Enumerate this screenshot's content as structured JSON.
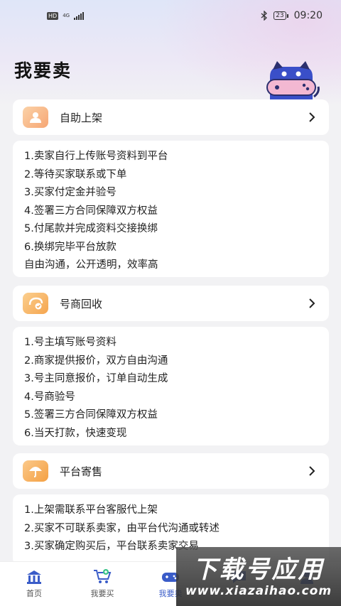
{
  "statusbar": {
    "hd": "HD",
    "network": "4G",
    "battery": "23",
    "time": "09:20"
  },
  "page": {
    "title": "我要卖"
  },
  "cards": [
    {
      "label": "自助上架",
      "icon": "user-icon",
      "lines": [
        "1.卖家自行上传账号资料到平台",
        "2.等待买家联系或下单",
        "3.买家付定金并验号",
        "4.签署三方合同保障双方权益",
        "5.付尾款并完成资料交接换绑",
        "6.换绑完毕平台放款",
        "自由沟通，公开透明，效率高"
      ]
    },
    {
      "label": "号商回收",
      "icon": "recycle-icon",
      "lines": [
        "1.号主填写账号资料",
        "2.商家提供报价，双方自由沟通",
        "3.号主同意报价，订单自动生成",
        "4.号商验号",
        "5.签署三方合同保障双方权益",
        "6.当天打款，快速变现"
      ]
    },
    {
      "label": "平台寄售",
      "icon": "umbrella-icon",
      "lines": [
        "1.上架需联系平台客服代上架",
        "2.买家不可联系卖家，由平台代沟通或转述",
        "3.买家确定购买后，平台联系卖家交易"
      ]
    }
  ],
  "tabbar": {
    "tabs": [
      {
        "label": "首页",
        "icon": "home-icon"
      },
      {
        "label": "我要买",
        "icon": "cart-icon"
      },
      {
        "label": "我要卖",
        "icon": "gamepad-icon"
      },
      {
        "label": "",
        "icon": "message-icon"
      },
      {
        "label": "",
        "icon": "profile-icon"
      }
    ]
  },
  "watermark": {
    "main": "下载号应用",
    "sub": "www.xiazaihao.com"
  },
  "colors": {
    "accent": "#3a5cc8",
    "card1_icon": "#f7b98a",
    "card2_icon": "#f6b267",
    "card3_icon": "#f6ae55"
  }
}
